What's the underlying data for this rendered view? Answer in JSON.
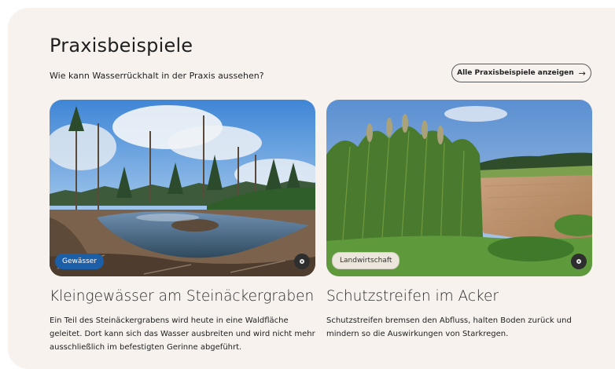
{
  "section": {
    "title": "Praxisbeispiele",
    "subtitle": "Wie kann Wasserrückhalt in der Praxis aussehen?",
    "all_button_label": "Alle Praxisbeispiele anzeigen",
    "all_button_arrow": "→"
  },
  "cards": [
    {
      "tag": "Gewässer",
      "tag_color": "#1b5fa8",
      "title": "Kleingewässer am Steinäckergraben",
      "text": "Ein Teil des Steinäckergrabens wird heute in eine Waldfläche geleitet. Dort kann sich das Wasser ausbreiten und wird nicht mehr ausschließlich im befestigten Gerinne abgeführt."
    },
    {
      "tag": "Landwirtschaft",
      "tag_color": "#ece6dc",
      "title": "Schutzstreifen im Acker",
      "text": "Schutzstreifen bremsen den Abfluss, halten Boden zurück und mindern so die Auswirkungen von Starkregen."
    }
  ],
  "colors": {
    "panel_background": "#f7f2ee",
    "accent_blue": "#1b5fa8"
  }
}
